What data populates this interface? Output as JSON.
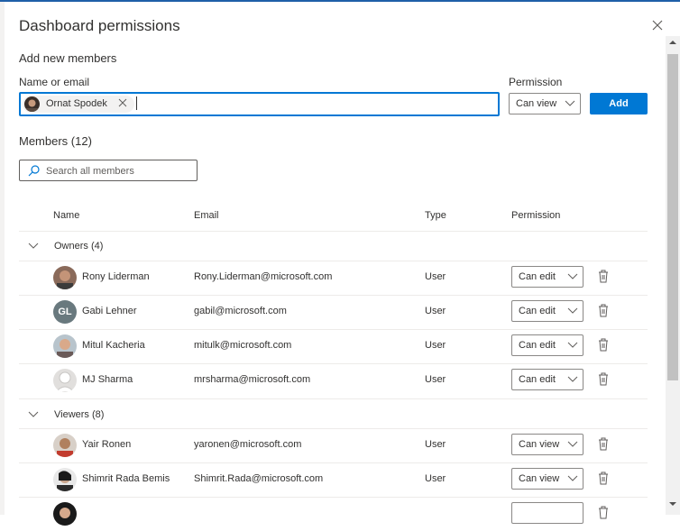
{
  "dialog": {
    "title": "Dashboard permissions"
  },
  "add_section": {
    "heading": "Add new members",
    "name_label": "Name or email",
    "selected_person": "Ornat Spodek",
    "permission_label": "Permission",
    "permission_value": "Can view",
    "add_label": "Add"
  },
  "members": {
    "heading": "Members (12)",
    "search_placeholder": "Search all members",
    "columns": {
      "name": "Name",
      "email": "Email",
      "type": "Type",
      "permission": "Permission"
    },
    "groups": [
      {
        "label": "Owners (4)",
        "rows": [
          {
            "name": "Rony Liderman",
            "email": "Rony.Liderman@microsoft.com",
            "type": "User",
            "permission": "Can edit",
            "avatar": "photo"
          },
          {
            "name": "Gabi Lehner",
            "email": "gabil@microsoft.com",
            "type": "User",
            "permission": "Can edit",
            "avatar": "initials",
            "initials": "GL"
          },
          {
            "name": "Mitul Kacheria",
            "email": "mitulk@microsoft.com",
            "type": "User",
            "permission": "Can edit",
            "avatar": "photo"
          },
          {
            "name": "MJ Sharma",
            "email": "mrsharma@microsoft.com",
            "type": "User",
            "permission": "Can edit",
            "avatar": "silhouette"
          }
        ]
      },
      {
        "label": "Viewers (8)",
        "rows": [
          {
            "name": "Yair Ronen",
            "email": "yaronen@microsoft.com",
            "type": "User",
            "permission": "Can view",
            "avatar": "photo"
          },
          {
            "name": "Shimrit Rada Bemis",
            "email": "Shimrit.Rada@microsoft.com",
            "type": "User",
            "permission": "Can view",
            "avatar": "photo"
          }
        ]
      }
    ]
  },
  "icons": {
    "close": "close-icon",
    "remove": "remove-person-icon",
    "search": "search-icon",
    "chevron": "chevron-down-icon",
    "delete": "trash-icon"
  },
  "colors": {
    "accent": "#0078d4",
    "border": "#8a8886"
  }
}
